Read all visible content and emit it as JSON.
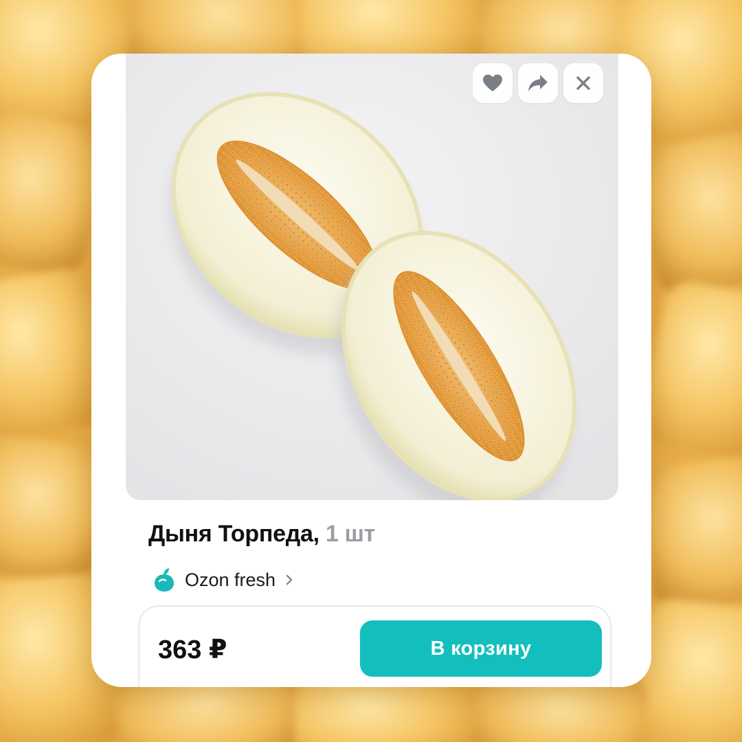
{
  "product": {
    "name": "Дыня Торпеда,",
    "quantity": "1 шт"
  },
  "store": {
    "name": "Ozon fresh"
  },
  "purchase": {
    "price": "363 ₽",
    "add_to_cart_label": "В корзину"
  },
  "actions": {
    "favorite_icon": "heart-icon",
    "share_icon": "share-icon",
    "close_icon": "close-icon"
  },
  "colors": {
    "accent": "#13bfbd",
    "background_fruit": "#f2c25e",
    "quantity_text": "#9a9ea4",
    "store_logo": "#18b9b6"
  }
}
